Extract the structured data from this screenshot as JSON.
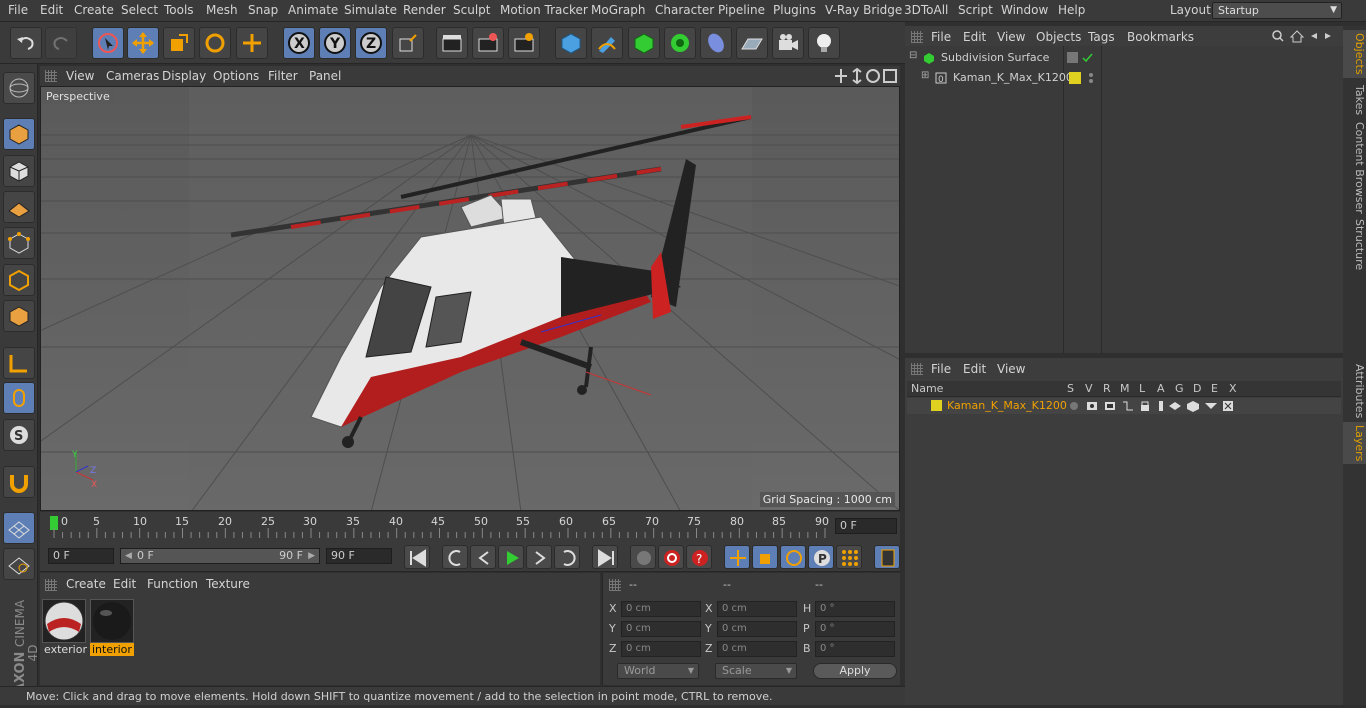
{
  "menubar": {
    "items": [
      "File",
      "Edit",
      "Create",
      "Select",
      "Tools",
      "Mesh",
      "Snap",
      "Animate",
      "Simulate",
      "Render",
      "Sculpt",
      "Motion Tracker",
      "MoGraph",
      "Character",
      "Pipeline",
      "Plugins",
      "V-Ray Bridge",
      "3DToAll",
      "Script",
      "Window",
      "Help"
    ],
    "layout_label": "Layout:",
    "layout_value": "Startup"
  },
  "viewport": {
    "menu": [
      "View",
      "Cameras",
      "Display",
      "Options",
      "Filter",
      "Panel"
    ],
    "label": "Perspective",
    "grid_spacing": "Grid Spacing : 1000 cm"
  },
  "timeline": {
    "ticks": [
      "0",
      "5",
      "10",
      "15",
      "20",
      "25",
      "30",
      "35",
      "40",
      "45",
      "50",
      "55",
      "60",
      "65",
      "70",
      "75",
      "80",
      "85",
      "90"
    ],
    "current_frame": "0 F"
  },
  "transport": {
    "start_field": "0 F",
    "range_start": "0 F",
    "range_end": "90 F",
    "end_field": "90 F"
  },
  "material_manager": {
    "menu": [
      "Create",
      "Edit",
      "Function",
      "Texture"
    ],
    "materials": [
      {
        "name": "exterior",
        "selected": false
      },
      {
        "name": "interior",
        "selected": true
      }
    ]
  },
  "coordinates": {
    "headers": [
      "--",
      "--",
      "--"
    ],
    "rows": [
      {
        "a": "X",
        "av": "0 cm",
        "b": "X",
        "bv": "0 cm",
        "c": "H",
        "cv": "0 °"
      },
      {
        "a": "Y",
        "av": "0 cm",
        "b": "Y",
        "bv": "0 cm",
        "c": "P",
        "cv": "0 °"
      },
      {
        "a": "Z",
        "av": "0 cm",
        "b": "Z",
        "bv": "0 cm",
        "c": "B",
        "cv": "0 °"
      }
    ],
    "mode": "World",
    "scale": "Scale",
    "apply": "Apply"
  },
  "object_manager": {
    "menu": [
      "File",
      "Edit",
      "View",
      "Objects",
      "Tags",
      "Bookmarks"
    ],
    "objects": [
      {
        "name": "Subdivision Surface",
        "color": "#c8c8c8"
      },
      {
        "name": "Kaman_K_Max_K1200",
        "color": "#c8c8c8",
        "tag_color": "#e0d020"
      }
    ]
  },
  "layer_manager": {
    "menu": [
      "File",
      "Edit",
      "View"
    ],
    "columns": [
      "Name",
      "S",
      "V",
      "R",
      "M",
      "L",
      "A",
      "G",
      "D",
      "E",
      "X"
    ],
    "layers": [
      {
        "name": "Kaman_K_Max_K1200",
        "color": "#e0d020"
      }
    ]
  },
  "right_tabs": [
    "Objects",
    "Takes",
    "Content Browser",
    "Structure",
    "Attributes",
    "Layers"
  ],
  "status": "Move: Click and drag to move elements. Hold down SHIFT to quantize movement / add to the selection in point mode, CTRL to remove.",
  "brand": {
    "line1": "MAXON",
    "line2": "CINEMA 4D"
  },
  "colors": {
    "accent": "#5e7fb5",
    "highlight": "#f0a000",
    "layer_color": "#e0d020"
  }
}
